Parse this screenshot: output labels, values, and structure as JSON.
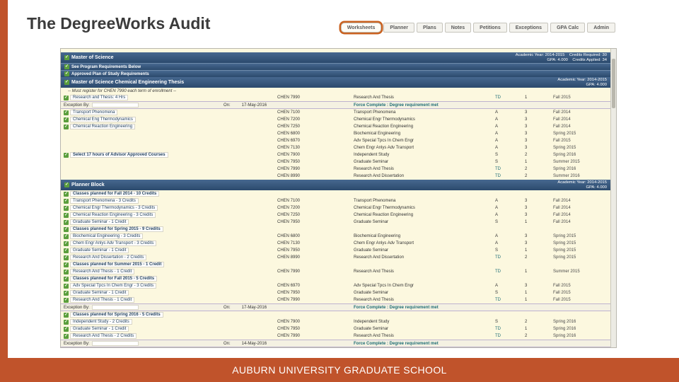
{
  "slide": {
    "title": "The DegreeWorks Audit",
    "footer": "AUBURN UNIVERSITY GRADUATE SCHOOL",
    "accent_color": "#c0532b"
  },
  "tabs": [
    {
      "label": "Worksheets",
      "active": true
    },
    {
      "label": "Planner",
      "active": false
    },
    {
      "label": "Plans",
      "active": false
    },
    {
      "label": "Notes",
      "active": false
    },
    {
      "label": "Petitions",
      "active": false
    },
    {
      "label": "Exceptions",
      "active": false
    },
    {
      "label": "GPA Calc",
      "active": false
    },
    {
      "label": "Admin",
      "active": false
    }
  ],
  "audit": {
    "rows": [
      {
        "type": "header",
        "title": "Master of Science",
        "meta_top": "Academic Year: 2014-2015    Credits Required: 30",
        "meta_bottom": "GPA: 4.000    Credits Applied: 34"
      },
      {
        "type": "subbar",
        "label": "See Program Requirements Below"
      },
      {
        "type": "subbar",
        "label": "Approved Plan of Study Requirements"
      },
      {
        "type": "header",
        "title": "Master of Science Chemical Engineering Thesis",
        "meta_top": "Academic Year: 2014-2015",
        "meta_bottom": "GPA: 4.000"
      },
      {
        "type": "note",
        "text": "-- Must register for CHEN 7990 each term of enrollment --"
      },
      {
        "type": "course",
        "label": "Research and Thesis: 4 Hrs",
        "code": "CHEN 7990",
        "course": "Research And Thesis",
        "grade": "TD",
        "credits": "1",
        "term": "Fall 2015"
      },
      {
        "type": "exception",
        "label": "Exception By:",
        "on_label": "On:",
        "date": "17-May-2016",
        "text": "Force Complete : Degree requirement met"
      },
      {
        "type": "course",
        "label": "Transport Phenomena",
        "code": "CHEN 7100",
        "course": "Transport Phenomena",
        "grade": "A",
        "credits": "3",
        "term": "Fall 2014"
      },
      {
        "type": "course",
        "label": "Chemical Eng Thermodynamics",
        "code": "CHEN 7200",
        "course": "Chemical Engr Thermodynamics",
        "grade": "A",
        "credits": "3",
        "term": "Fall 2014"
      },
      {
        "type": "course",
        "label": "Chemical Reaction Engineering",
        "code": "CHEN 7250",
        "course": "Chemical Reaction Engineering",
        "grade": "A",
        "credits": "3",
        "term": "Fall 2014"
      },
      {
        "type": "course",
        "label": "",
        "code": "CHEN 6800",
        "course": "Biochemical Engineering",
        "grade": "A",
        "credits": "3",
        "term": "Spring 2015"
      },
      {
        "type": "course",
        "label": "",
        "code": "CHEN 6970",
        "course": "Adv Special Tpcs In Chem Engr",
        "grade": "A",
        "credits": "3",
        "term": "Fall 2015"
      },
      {
        "type": "course",
        "label": "",
        "code": "CHEN 7130",
        "course": "Chem Engr Anlys Adv Transport",
        "grade": "A",
        "credits": "3",
        "term": "Spring 2015"
      },
      {
        "type": "course",
        "label": "Select 17 hours of Advisor Approved Courses",
        "bold": true,
        "code": "CHEN 7900",
        "course": "Independent Study",
        "grade": "S",
        "credits": "2",
        "term": "Spring 2016"
      },
      {
        "type": "course",
        "label": "",
        "code": "CHEN 7950",
        "course": "Graduate Seminar",
        "grade": "S",
        "credits": "1",
        "term": "Summer 2015"
      },
      {
        "type": "course",
        "label": "",
        "code": "CHEN 7990",
        "course": "Research And Thesis",
        "grade": "TD",
        "credits": "2",
        "term": "Spring 2016"
      },
      {
        "type": "course",
        "label": "",
        "code": "CHEN 8990",
        "course": "Research And Dissertation",
        "grade": "TD",
        "credits": "2",
        "term": "Summer 2016"
      },
      {
        "type": "header",
        "title": "Planner Block",
        "meta_top": "Academic Year: 2014-2015",
        "meta_bottom": "GPA: 4.000"
      },
      {
        "type": "group",
        "label": "Classes planned for Fall 2014 - 10 Credits"
      },
      {
        "type": "course",
        "label": "Transport Phenomena - 3 Credits",
        "code": "CHEN 7100",
        "course": "Transport Phenomena",
        "grade": "A",
        "credits": "3",
        "term": "Fall 2014"
      },
      {
        "type": "course",
        "label": "Chemical Engr Thermodynamics - 3 Credits",
        "code": "CHEN 7200",
        "course": "Chemical Engr Thermodynamics",
        "grade": "A",
        "credits": "3",
        "term": "Fall 2014"
      },
      {
        "type": "course",
        "label": "Chemical Reaction Engineering - 3 Credits",
        "code": "CHEN 7250",
        "course": "Chemical Reaction Engineering",
        "grade": "A",
        "credits": "3",
        "term": "Fall 2014"
      },
      {
        "type": "course",
        "label": "Graduate Seminar - 1 Credit",
        "code": "CHEN 7950",
        "course": "Graduate Seminar",
        "grade": "S",
        "credits": "1",
        "term": "Fall 2014"
      },
      {
        "type": "group",
        "label": "Classes planned for Spring 2015 - 9 Credits"
      },
      {
        "type": "course",
        "label": "Biochemical Engineering - 3 Credits",
        "code": "CHEN 6800",
        "course": "Biochemical Engineering",
        "grade": "A",
        "credits": "3",
        "term": "Spring 2015"
      },
      {
        "type": "course",
        "label": "Chem Engr Anlys Adv Transport - 3 Credits",
        "code": "CHEN 7130",
        "course": "Chem Engr Anlys Adv Transport",
        "grade": "A",
        "credits": "3",
        "term": "Spring 2015"
      },
      {
        "type": "course",
        "label": "Graduate Seminar - 1 Credit",
        "code": "CHEN 7950",
        "course": "Graduate Seminar",
        "grade": "S",
        "credits": "1",
        "term": "Spring 2015"
      },
      {
        "type": "course",
        "label": "Research And Dissertation - 2 Credits",
        "code": "CHEN 8990",
        "course": "Research And Dissertation",
        "grade": "TD",
        "credits": "2",
        "term": "Spring 2015"
      },
      {
        "type": "group",
        "label": "Classes planned for Summer 2015 - 1 Credit"
      },
      {
        "type": "course",
        "label": "Research And Thesis - 1 Credit",
        "code": "CHEN 7990",
        "course": "Research And Thesis",
        "grade": "TD",
        "credits": "1",
        "term": "Summer 2015"
      },
      {
        "type": "group",
        "label": "Classes planned for Fall 2015 - 5 Credits"
      },
      {
        "type": "course",
        "label": "Adv Special Tpcs In Chem Engr - 3 Credits",
        "code": "CHEN 6970",
        "course": "Adv Special Tpcs In Chem Engr",
        "grade": "A",
        "credits": "3",
        "term": "Fall 2015"
      },
      {
        "type": "course",
        "label": "Graduate Seminar - 1 Credit",
        "code": "CHEN 7950",
        "course": "Graduate Seminar",
        "grade": "S",
        "credits": "1",
        "term": "Fall 2015"
      },
      {
        "type": "course",
        "label": "Research And Thesis - 1 Credit",
        "code": "CHEN 7990",
        "course": "Research And Thesis",
        "grade": "TD",
        "credits": "1",
        "term": "Fall 2015"
      },
      {
        "type": "exception",
        "label": "Exception By:",
        "on_label": "On:",
        "date": "17-May-2016",
        "text": "Force Complete : Degree requirement met"
      },
      {
        "type": "group",
        "label": "Classes planned for Spring 2016 - 5 Credits"
      },
      {
        "type": "course",
        "label": "Independent Study - 2 Credits",
        "code": "CHEN 7900",
        "course": "Independent Study",
        "grade": "S",
        "credits": "2",
        "term": "Spring 2016"
      },
      {
        "type": "course",
        "label": "Graduate Seminar - 1 Credit",
        "code": "CHEN 7950",
        "course": "Graduate Seminar",
        "grade": "TD",
        "credits": "1",
        "term": "Spring 2016"
      },
      {
        "type": "course",
        "label": "Research And Thesis - 2 Credits",
        "code": "CHEN 7990",
        "course": "Research And Thesis",
        "grade": "TD",
        "credits": "2",
        "term": "Spring 2016"
      },
      {
        "type": "exception",
        "label": "Exception By:",
        "on_label": "On:",
        "date": "14-May-2016",
        "text": "Force Complete : Degree requirement met"
      }
    ]
  }
}
